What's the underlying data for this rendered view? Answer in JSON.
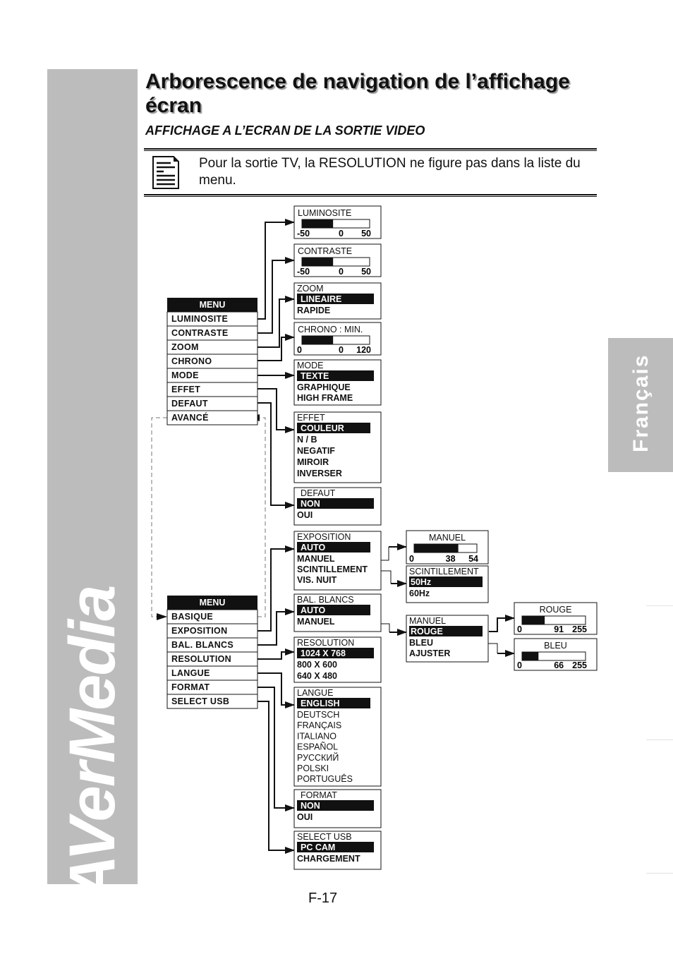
{
  "sidebar": {
    "brand": "AVerMedia"
  },
  "language_tab": {
    "label": "Français"
  },
  "header": {
    "title": "Arborescence de navigation de l’affichage écran",
    "subtitle": "AFFICHAGE A L’ECRAN DE LA SORTIE VIDEO"
  },
  "note": {
    "icon": "document-note-icon",
    "text": "Pour la sortie TV, la RESOLUTION ne figure pas dans la liste du menu."
  },
  "menus": {
    "basic": {
      "title": "MENU",
      "items": [
        "LUMINOSITE",
        "CONTRASTE",
        "ZOOM",
        "CHRONO",
        "MODE",
        "EFFET",
        "DEFAUT",
        "AVANCÉ"
      ]
    },
    "advanced": {
      "title": "MENU",
      "items": [
        "BASIQUE",
        "EXPOSITION",
        "BAL. BLANCS",
        "RESOLUTION",
        "LANGUE",
        "FORMAT",
        "SELECT USB"
      ]
    }
  },
  "submenus": {
    "luminosite": {
      "title": "LUMINOSITE",
      "slider": {
        "min": -50,
        "value": 0,
        "max": 50
      }
    },
    "contraste": {
      "title": "CONTRASTE",
      "slider": {
        "min": -50,
        "value": 0,
        "max": 50
      }
    },
    "zoom": {
      "title": "ZOOM",
      "selected": "LINEAIRE",
      "options": [
        "RAPIDE"
      ]
    },
    "chrono": {
      "title": "CHRONO : MIN.",
      "slider": {
        "min": 0,
        "value": 0,
        "max": 120
      }
    },
    "mode": {
      "title": "MODE",
      "selected": "TEXTE",
      "options": [
        "GRAPHIQUE",
        "HIGH FRAME"
      ]
    },
    "effet": {
      "title": "EFFET",
      "selected": "COULEUR",
      "options": [
        "N / B",
        "NEGATIF",
        "MIROIR",
        "INVERSER"
      ]
    },
    "defaut": {
      "title": "DEFAUT",
      "selected": "NON",
      "options": [
        "OUI"
      ]
    },
    "exposition": {
      "title": "EXPOSITION",
      "selected": "AUTO",
      "options": [
        "MANUEL",
        "SCINTILLEMENT",
        "VIS. NUIT"
      ]
    },
    "exposition_manuel": {
      "title": "MANUEL",
      "slider": {
        "min": 0,
        "value": 38,
        "max": 54
      }
    },
    "scintillement": {
      "title": "SCINTILLEMENT",
      "selected": "50Hz",
      "options": [
        "60Hz"
      ]
    },
    "bal_blancs": {
      "title": "BAL. BLANCS",
      "selected": "AUTO",
      "options": [
        "MANUEL"
      ]
    },
    "bal_manuel": {
      "title": "MANUEL",
      "selected": "ROUGE",
      "options": [
        "BLEU",
        "AJUSTER"
      ]
    },
    "rouge": {
      "title": "ROUGE",
      "slider": {
        "min": 0,
        "value": 91,
        "max": 255
      }
    },
    "bleu": {
      "title": "BLEU",
      "slider": {
        "min": 0,
        "value": 66,
        "max": 255
      }
    },
    "resolution": {
      "title": "RESOLUTION",
      "selected": "1024 X 768",
      "options": [
        "800 X 600",
        "640 X 480"
      ]
    },
    "langue": {
      "title": "LANGUE",
      "selected": "ENGLISH",
      "options": [
        "DEUTSCH",
        "FRANÇAIS",
        "ITALIANO",
        "ESPAÑOL",
        "РУССКИЙ",
        "POLSKI",
        "PORTUGUÊS"
      ]
    },
    "format": {
      "title": "FORMAT",
      "selected": "NON",
      "options": [
        "OUI"
      ]
    },
    "select_usb": {
      "title": "SELECT USB",
      "selected": "PC CAM",
      "options": [
        "CHARGEMENT"
      ]
    }
  },
  "footer": {
    "page_number": "F-17"
  }
}
